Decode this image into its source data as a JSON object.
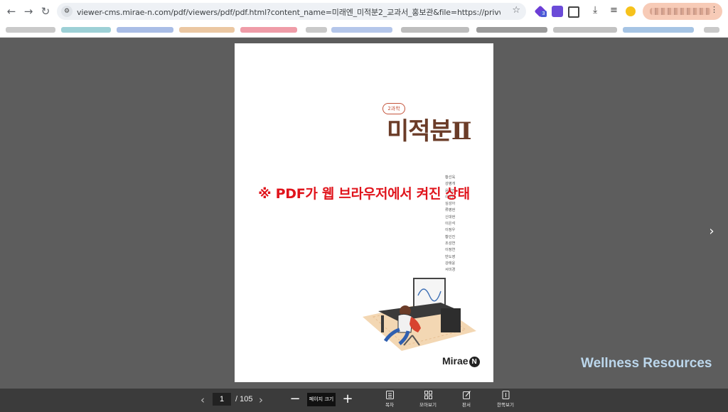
{
  "browser": {
    "url": "viewer-cms.mirae-n.com/pdf/viewers/pdf/pdf.html?content_name=미래엔_미적분2_교과서_홍보관&file=https://privw-cms.mirae-n.com/docu…",
    "badge_count": "3",
    "menu_glyph": "⋮"
  },
  "document": {
    "grade_badge": "2과학",
    "book_title": "미적분Ⅱ",
    "authors": [
      "황선욱",
      "강병개",
      "윤갑진",
      "이문연",
      "심성아",
      "류병현",
      "신대현",
      "이은석",
      "이정우",
      "황인진",
      "조성연",
      "이정연",
      "반도영",
      "강태윤",
      "서미경"
    ],
    "overlay_caption": "※ PDF가 웹 브라우저에서 켜진 상태",
    "publisher": "Mirae",
    "publisher_mark": "N"
  },
  "viewer": {
    "watermark": "Wellness Resources"
  },
  "pagination": {
    "current_page": "1",
    "total_label": "/ 105",
    "zoom_label": "페이지 크기"
  },
  "tools": [
    {
      "label": "목차"
    },
    {
      "label": "모아보기"
    },
    {
      "label": "판서"
    },
    {
      "label": "한쪽보기"
    }
  ]
}
